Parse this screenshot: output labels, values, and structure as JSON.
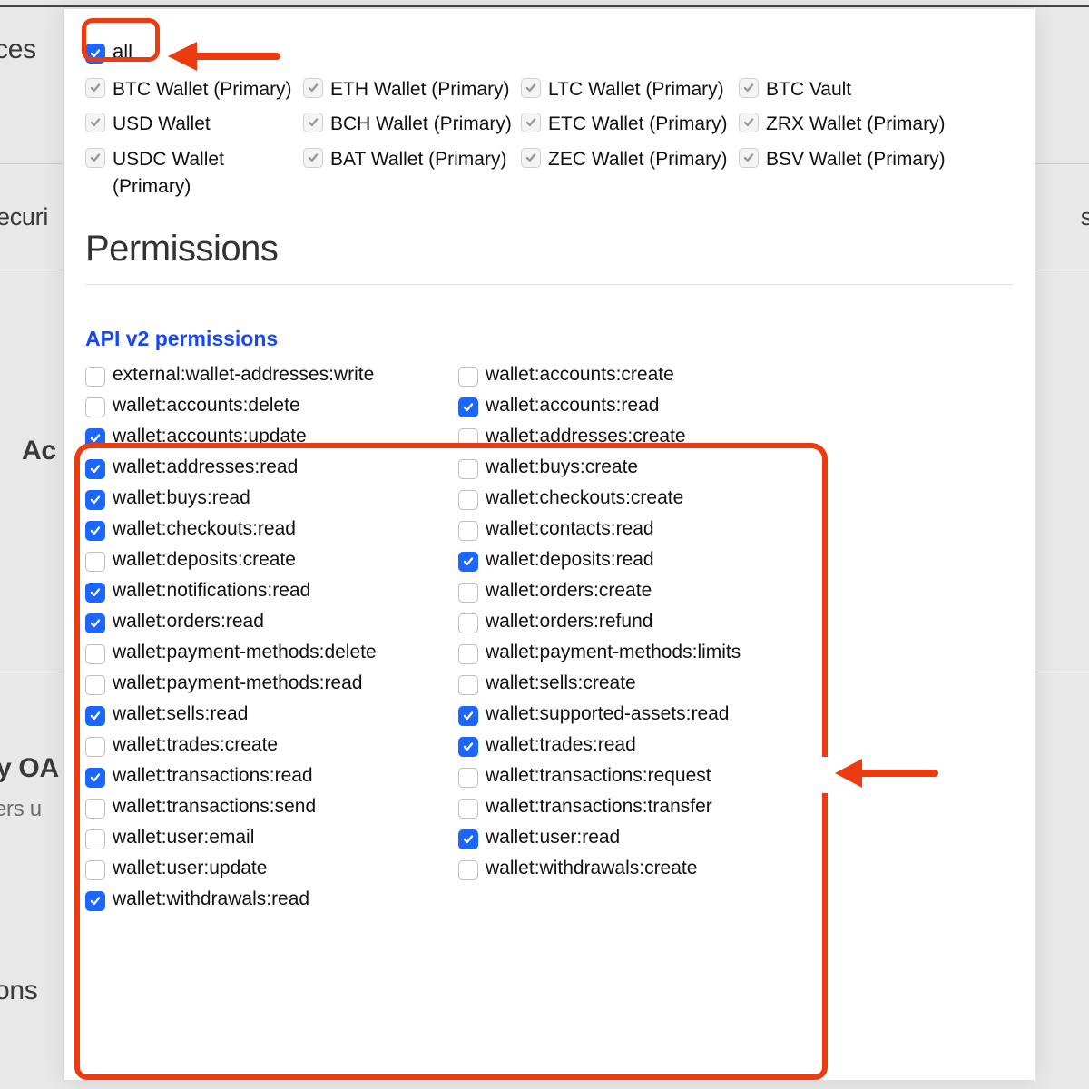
{
  "bg": {
    "ces": "ces",
    "securi": "ecuri",
    "ac": "Ac",
    "yoau": "y OA",
    "hersU": "ers u",
    "ons": "ons",
    "s_right": "s"
  },
  "accounts": {
    "all_label": "all",
    "items": [
      {
        "label": "BTC Wallet (Primary)",
        "checked": true
      },
      {
        "label": "ETH Wallet (Primary)",
        "checked": true
      },
      {
        "label": "LTC Wallet (Primary)",
        "checked": true
      },
      {
        "label": "BTC Vault",
        "checked": true
      },
      {
        "label": "USD Wallet",
        "checked": true
      },
      {
        "label": "BCH Wallet (Primary)",
        "checked": true
      },
      {
        "label": "ETC Wallet (Primary)",
        "checked": true
      },
      {
        "label": "ZRX Wallet (Primary)",
        "checked": true
      },
      {
        "label": "USDC Wallet (Primary)",
        "checked": true
      },
      {
        "label": "BAT Wallet (Primary)",
        "checked": true
      },
      {
        "label": "ZEC Wallet (Primary)",
        "checked": true
      },
      {
        "label": "BSV Wallet (Primary)",
        "checked": true
      }
    ]
  },
  "headings": {
    "permissions": "Permissions",
    "api_v2": "API v2 permissions"
  },
  "permissions": [
    {
      "label": "external:wallet-addresses:write",
      "checked": false
    },
    {
      "label": "wallet:accounts:create",
      "checked": false
    },
    {
      "label": "wallet:accounts:delete",
      "checked": false
    },
    {
      "label": "wallet:accounts:read",
      "checked": true
    },
    {
      "label": "wallet:accounts:update",
      "checked": true
    },
    {
      "label": "wallet:addresses:create",
      "checked": false
    },
    {
      "label": "wallet:addresses:read",
      "checked": true
    },
    {
      "label": "wallet:buys:create",
      "checked": false
    },
    {
      "label": "wallet:buys:read",
      "checked": true
    },
    {
      "label": "wallet:checkouts:create",
      "checked": false
    },
    {
      "label": "wallet:checkouts:read",
      "checked": true
    },
    {
      "label": "wallet:contacts:read",
      "checked": false
    },
    {
      "label": "wallet:deposits:create",
      "checked": false
    },
    {
      "label": "wallet:deposits:read",
      "checked": true
    },
    {
      "label": "wallet:notifications:read",
      "checked": true
    },
    {
      "label": "wallet:orders:create",
      "checked": false
    },
    {
      "label": "wallet:orders:read",
      "checked": true
    },
    {
      "label": "wallet:orders:refund",
      "checked": false
    },
    {
      "label": "wallet:payment-methods:delete",
      "checked": false
    },
    {
      "label": "wallet:payment-methods:limits",
      "checked": false
    },
    {
      "label": "wallet:payment-methods:read",
      "checked": false
    },
    {
      "label": "wallet:sells:create",
      "checked": false
    },
    {
      "label": "wallet:sells:read",
      "checked": true
    },
    {
      "label": "wallet:supported-assets:read",
      "checked": true
    },
    {
      "label": "wallet:trades:create",
      "checked": false
    },
    {
      "label": "wallet:trades:read",
      "checked": true
    },
    {
      "label": "wallet:transactions:read",
      "checked": true
    },
    {
      "label": "wallet:transactions:request",
      "checked": false
    },
    {
      "label": "wallet:transactions:send",
      "checked": false
    },
    {
      "label": "wallet:transactions:transfer",
      "checked": false
    },
    {
      "label": "wallet:user:email",
      "checked": false
    },
    {
      "label": "wallet:user:read",
      "checked": true
    },
    {
      "label": "wallet:user:update",
      "checked": false
    },
    {
      "label": "wallet:withdrawals:create",
      "checked": false
    },
    {
      "label": "wallet:withdrawals:read",
      "checked": true
    }
  ]
}
